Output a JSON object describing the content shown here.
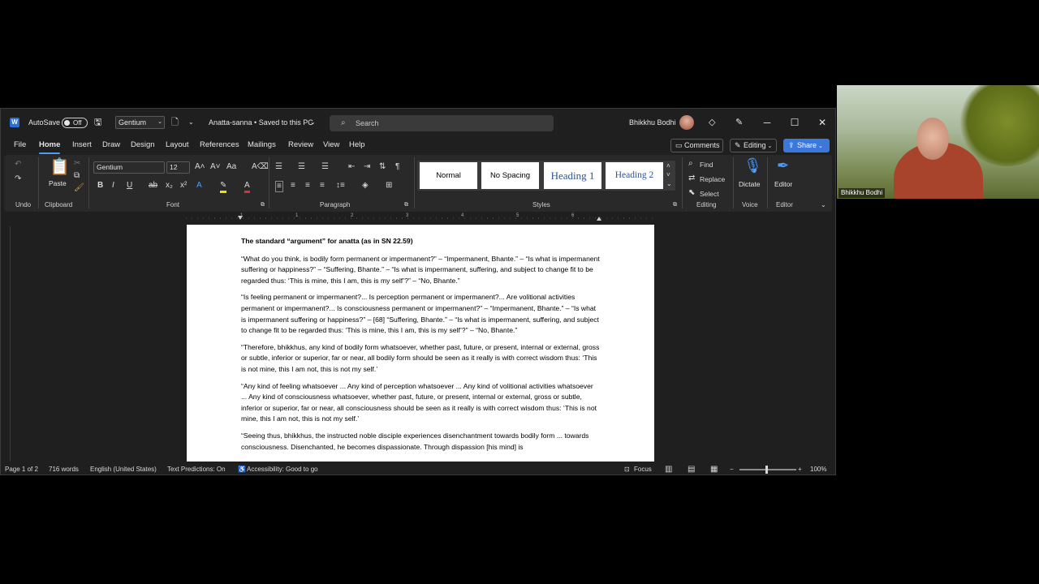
{
  "titlebar": {
    "app_icon": "word-icon",
    "autosave_label": "AutoSave",
    "autosave_state": "Off",
    "font_box": "Gentium",
    "doc_title": "Anatta-sanna • Saved to this PC",
    "search_placeholder": "Search",
    "user_name": "Bhikkhu Bodhi"
  },
  "tabs": [
    "File",
    "Home",
    "Insert",
    "Draw",
    "Design",
    "Layout",
    "References",
    "Mailings",
    "Review",
    "View",
    "Help"
  ],
  "active_tab": "Home",
  "right_buttons": {
    "comments": "Comments",
    "editing": "Editing",
    "share": "Share"
  },
  "ribbon": {
    "undo_group": "Undo",
    "clipboard_group": "Clipboard",
    "paste_label": "Paste",
    "font_group": "Font",
    "font_name": "Gentium",
    "font_size": "12",
    "paragraph_group": "Paragraph",
    "styles_group": "Styles",
    "styles": [
      "Normal",
      "No Spacing",
      "Heading 1",
      "Heading 2"
    ],
    "editing_group": "Editing",
    "find": "Find",
    "replace": "Replace",
    "select": "Select",
    "voice_group": "Voice",
    "dictate": "Dictate",
    "editor_group": "Editor",
    "editor": "Editor"
  },
  "ruler_numbers": [
    "1",
    "1",
    "2",
    "3",
    "4",
    "5",
    "6"
  ],
  "document": {
    "heading": "The standard “argument” for anatta (as in SN 22.59)",
    "paragraphs": [
      "“What do you think, is bodily form permanent or impermanent?” – “Impermanent, Bhante.” – “Is what is impermanent suffering or happiness?” – “Suffering, Bhante.” – “Is what is impermanent, suffering, and subject to change fit to be regarded thus: ‘This is mine, this I am, this is my self’?” – “No, Bhante.”",
      "“Is feeling permanent or impermanent?... Is perception permanent or impermanent?... Are volitional activities permanent or impermanent?... Is consciousness permanent or impermanent?” – “Impermanent, Bhante.” – “Is what is impermanent suffering or happiness?” – [68] “Suffering, Bhante.” – “Is what is impermanent, suffering, and subject to change fit to be regarded thus: ‘This is mine, this I am, this is my self’?” – “No, Bhante.”",
      "“Therefore, bhikkhus, any kind of bodily form whatsoever, whether past, future, or present, internal or external, gross or subtle, inferior or superior, far or near, all bodily form should be seen as it really is with correct wisdom thus: ‘This is not mine, this I am not, this is not my self.’",
      "“Any kind of feeling whatsoever ... Any kind of perception whatsoever ... Any kind of volitional activities whatsoever ... Any kind of consciousness whatsoever, whether past, future, or present, internal or external, gross or subtle, inferior or superior, far or near, all consciousness should be seen as it really is with correct wisdom thus: ‘This is not mine, this I am not, this is not my self.’",
      "“Seeing thus, bhikkhus, the instructed noble disciple experiences disenchantment towards bodily form ... towards consciousness. Disenchanted, he becomes dispassionate. Through dispassion [his mind] is"
    ]
  },
  "statusbar": {
    "page": "Page 1 of 2",
    "words": "716 words",
    "language": "English (United States)",
    "predictions": "Text Predictions: On",
    "accessibility": "Accessibility: Good to go",
    "focus": "Focus",
    "zoom": "100%"
  },
  "video": {
    "participant_name": "Bhikkhu Bodhi"
  },
  "colors": {
    "accent": "#4f9cf7",
    "share": "#3b78d9",
    "window_bg": "#1f1f1f",
    "ribbon_bg": "#292929"
  }
}
